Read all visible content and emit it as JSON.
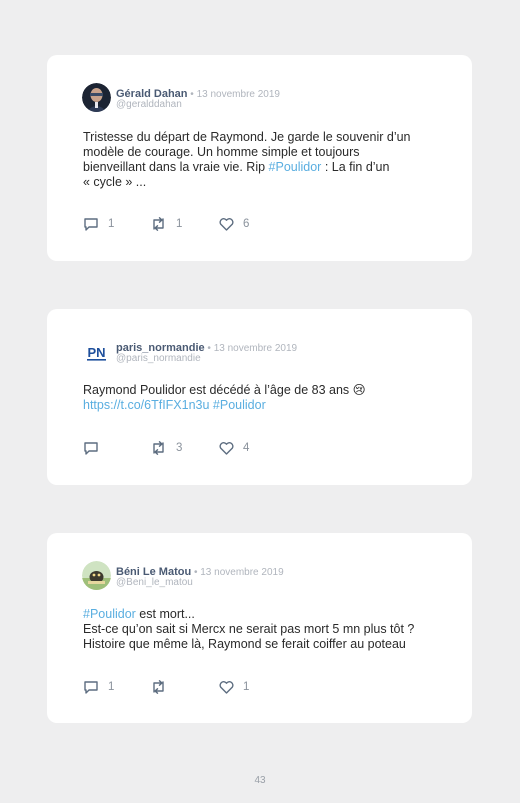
{
  "tweets": [
    {
      "name": "Gérald Dahan",
      "sep": " • ",
      "date": "13 novembre 2019",
      "handle": "@geralddahan",
      "lines": [
        {
          "text": "Tristesse du départ de Raymond. Je garde le souvenir d’un"
        },
        {
          "text": "modèle de courage. Un homme simple et toujours"
        },
        {
          "pre": "bienveillant dans la vraie vie. Rip ",
          "tag": "#Poulidor",
          "post": " : La fin d’un"
        },
        {
          "text": "« cycle » ..."
        }
      ],
      "replies": "1",
      "retweets": "1",
      "likes": "6"
    },
    {
      "name": "paris_normandie",
      "sep": " • ",
      "date": "13 novembre 2019",
      "handle": "@paris_normandie",
      "avatar_text": "PN",
      "lines": [
        {
          "text": "Raymond Poulidor est décédé à l’âge de 83 ans 😢"
        },
        {
          "pre": "",
          "tag": "https://t.co/6TfIFX1n3u #Poulidor",
          "post": ""
        }
      ],
      "replies": "",
      "retweets": "3",
      "likes": "4"
    },
    {
      "name": "Béni Le Matou",
      "sep": " • ",
      "date": "13 novembre 2019",
      "handle": "@Beni_le_matou",
      "lines": [
        {
          "pre": "",
          "tag": "#Poulidor",
          "post": " est mort..."
        },
        {
          "text": "Est-ce qu’on sait si Mercx ne serait pas mort 5 mn plus tôt ?"
        },
        {
          "text": "Histoire que même là, Raymond se ferait coiffer au poteau"
        }
      ],
      "replies": "1",
      "retweets": "",
      "likes": "1"
    }
  ],
  "colors": {
    "background": "#eeeeef",
    "card": "#ffffff",
    "name": "#4a5a73",
    "muted": "#b0b5bd",
    "hashtag": "#5aaee0",
    "icon": "#5d6d80"
  },
  "footer": {
    "page_number": "43"
  }
}
